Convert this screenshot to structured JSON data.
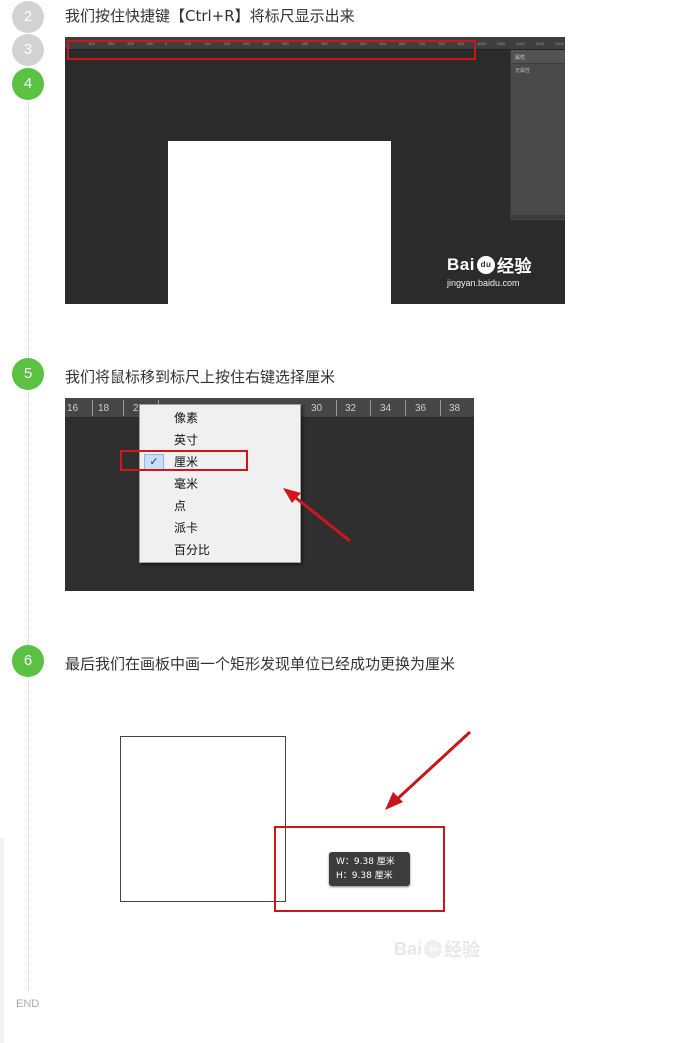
{
  "steps": [
    {
      "number": "2",
      "text": "我们按住快捷键【Ctrl+R】将标尺显示出来"
    },
    {
      "number": "3"
    },
    {
      "number": "4"
    },
    {
      "number": "5",
      "text": "我们将鼠标移到标尺上按住右键选择厘米"
    },
    {
      "number": "6",
      "text": "最后我们在画板中画一个矩形发现单位已经成功更换为厘米"
    }
  ],
  "end_label": "END",
  "colors": {
    "step_active": "#5ac142",
    "step_inactive": "#d2d2d2",
    "highlight": "#c8161d"
  },
  "shot1": {
    "ruler_ticks": [
      "-400",
      "-350",
      "-300",
      "-250",
      "0",
      "100",
      "150",
      "200",
      "250",
      "300",
      "350",
      "400",
      "450",
      "500",
      "550",
      "600",
      "650",
      "700",
      "750",
      "800",
      "1000",
      "1050",
      "1100",
      "1150",
      "1200"
    ],
    "panel_tab": "属性",
    "panel_row": "无属性",
    "watermark_brand": "Bai",
    "watermark_brand2": "经验",
    "watermark_paw": "du",
    "watermark_url": "jingyan.baidu.com"
  },
  "shot2": {
    "ruler_ticks": [
      "16",
      "18",
      "2",
      "30",
      "32",
      "34",
      "36",
      "38"
    ],
    "menu_items": [
      "像素",
      "英寸",
      "厘米",
      "毫米",
      "点",
      "派卡",
      "百分比"
    ],
    "selected_index": 2,
    "check_mark": "✓"
  },
  "shot3": {
    "tooltip": {
      "w_label": "W：",
      "w_value": "9.38 厘米",
      "h_label": "H：",
      "h_value": "9.38 厘米"
    },
    "watermark_brand": "Bai",
    "watermark_paw": "du",
    "watermark_brand2": "经验"
  }
}
